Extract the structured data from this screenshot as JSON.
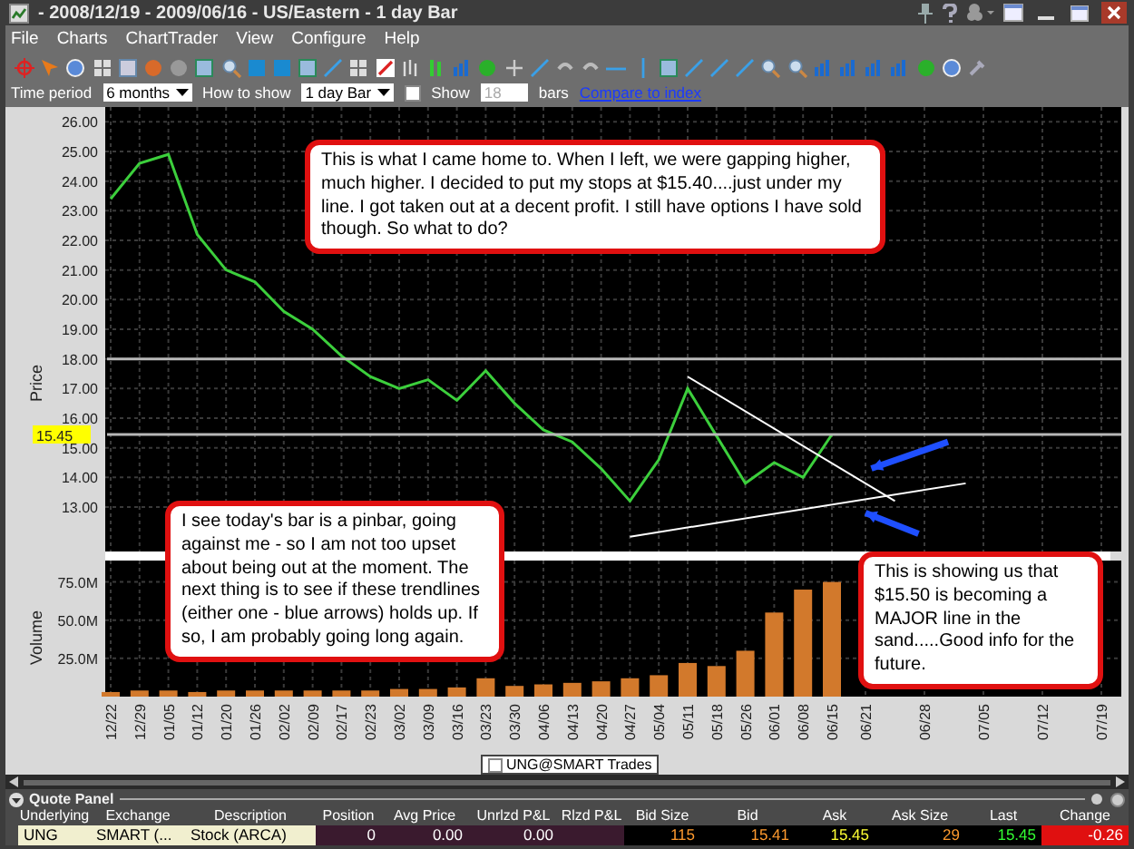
{
  "window": {
    "title": "- 2008/12/19 - 2009/06/16 - US/Eastern - 1 day Bar"
  },
  "menu": [
    "File",
    "Charts",
    "ChartTrader",
    "View",
    "Configure",
    "Help"
  ],
  "settings": {
    "time_period_label": "Time period",
    "time_period": "6 months",
    "how_to_show_label": "How to show",
    "how_to_show": "1 day Bar",
    "show": {
      "label": "Show",
      "checked": false
    },
    "bars_field": "18",
    "bars_label": "bars",
    "compare_link": "Compare to index"
  },
  "price_chart": {
    "price_marker": "15.45",
    "chart_data": {
      "type": "line",
      "ylabel": "Price",
      "grid": true,
      "series": [
        {
          "color": "#3ccf3c",
          "values": [
            23.4,
            24.6,
            24.9,
            22.2,
            21.0,
            20.6,
            19.6,
            19.0,
            18.1,
            17.4,
            17.0,
            17.3,
            16.6,
            17.6,
            16.5,
            15.6,
            15.2,
            14.3,
            13.2,
            14.6,
            17.0,
            15.4,
            13.8,
            14.5,
            14.0,
            15.45
          ]
        }
      ],
      "ylim": [
        11.5,
        26.5
      ],
      "yticks": [
        {
          "value": 13,
          "label": "13.00"
        },
        {
          "value": 14,
          "label": "14.00"
        },
        {
          "value": 15,
          "label": "15.00"
        },
        {
          "value": 16,
          "label": "16.00"
        },
        {
          "value": 17,
          "label": "17.00"
        },
        {
          "value": 18,
          "label": "18.00"
        },
        {
          "value": 19,
          "label": "19.00"
        },
        {
          "value": 20,
          "label": "20.00"
        },
        {
          "value": 21,
          "label": "21.00"
        },
        {
          "value": 22,
          "label": "22.00"
        },
        {
          "value": 23,
          "label": "23.00"
        },
        {
          "value": 24,
          "label": "24.00"
        },
        {
          "value": 25,
          "label": "25.00"
        },
        {
          "value": 26,
          "label": "26.00"
        }
      ]
    }
  },
  "volume_chart": {
    "chart_data": {
      "type": "bar",
      "ylabel": "Volume",
      "categories": [
        "12/22",
        "12/29",
        "01/05",
        "01/12",
        "01/20",
        "01/26",
        "02/02",
        "02/09",
        "02/17",
        "02/23",
        "03/02",
        "03/09",
        "03/16",
        "03/23",
        "03/30",
        "04/06",
        "04/13",
        "04/20",
        "04/27",
        "05/04",
        "05/11",
        "05/18",
        "05/26",
        "06/01",
        "06/08",
        "06/15"
      ],
      "grid": true,
      "series": [
        {
          "color": "#d2792c",
          "values": [
            3,
            4,
            4,
            3,
            4,
            4,
            4,
            4,
            4,
            4,
            5,
            5,
            6,
            12,
            7,
            8,
            9,
            10,
            12,
            14,
            22,
            20,
            30,
            55,
            70,
            75
          ]
        }
      ],
      "ylim": [
        0,
        89
      ],
      "yticks": [
        {
          "value": 25,
          "label": "25.0M"
        },
        {
          "value": 50,
          "label": "50.0M"
        },
        {
          "value": 75,
          "label": "75.0M"
        }
      ]
    },
    "future_dates": [
      "06/21",
      "06/28",
      "07/05",
      "07/12",
      "07/19"
    ]
  },
  "legend": {
    "label": "UNG@SMART Trades",
    "checked": false
  },
  "callouts": [
    {
      "text": "This is what I came home to. When I left, we were gapping higher, much higher. I decided to put my stops at $15.40....just under my line. I got taken out at a decent profit. I still have options I have sold though. So what to do?"
    },
    {
      "text": "I see today's bar is a pinbar, going against me - so I am not too upset about being out at the moment. The next thing is to see if these trendlines (either one - blue arrows) holds up. If so, I am probably going long again."
    },
    {
      "text": "This is showing us that $15.50 is becoming a MAJOR line in the sand.....Good info for the future."
    }
  ],
  "quote_panel": {
    "title": "Quote Panel",
    "columns": [
      "Underlying",
      "Exchange",
      "Description",
      "Position",
      "Avg Price",
      "Unrlzd P&L",
      "Rlzd P&L",
      "Bid Size",
      "Bid",
      "Ask",
      "Ask Size",
      "Last",
      "Change"
    ],
    "row": [
      {
        "text": "UNG",
        "kind": "label",
        "color": "#f1efcf"
      },
      {
        "text": "SMART (...",
        "kind": "label",
        "color": "#f1efcf"
      },
      {
        "text": "Stock (ARCA)",
        "kind": "label",
        "color": "#f1efcf"
      },
      {
        "text": "0",
        "kind": "plain",
        "color": "#3a1a2e"
      },
      {
        "text": "0.00",
        "kind": "plain",
        "color": "#3a1a2e"
      },
      {
        "text": "0.00",
        "kind": "plain",
        "color": "#3a1a2e"
      },
      {
        "kind": "plain",
        "color": "#3a1a2e"
      },
      {
        "text": "115",
        "kind": "bid",
        "color": "#000000"
      },
      {
        "text": "15.41",
        "kind": "bid",
        "color": "#000000"
      },
      {
        "text": "15.45",
        "kind": "ask",
        "color": "#000000"
      },
      {
        "text": "29",
        "kind": "bid",
        "color": "#000000"
      },
      {
        "text": "15.45",
        "kind": "last",
        "color": "#000000"
      },
      {
        "text": "-0.26",
        "kind": "plain",
        "color": "#e01010"
      }
    ]
  }
}
